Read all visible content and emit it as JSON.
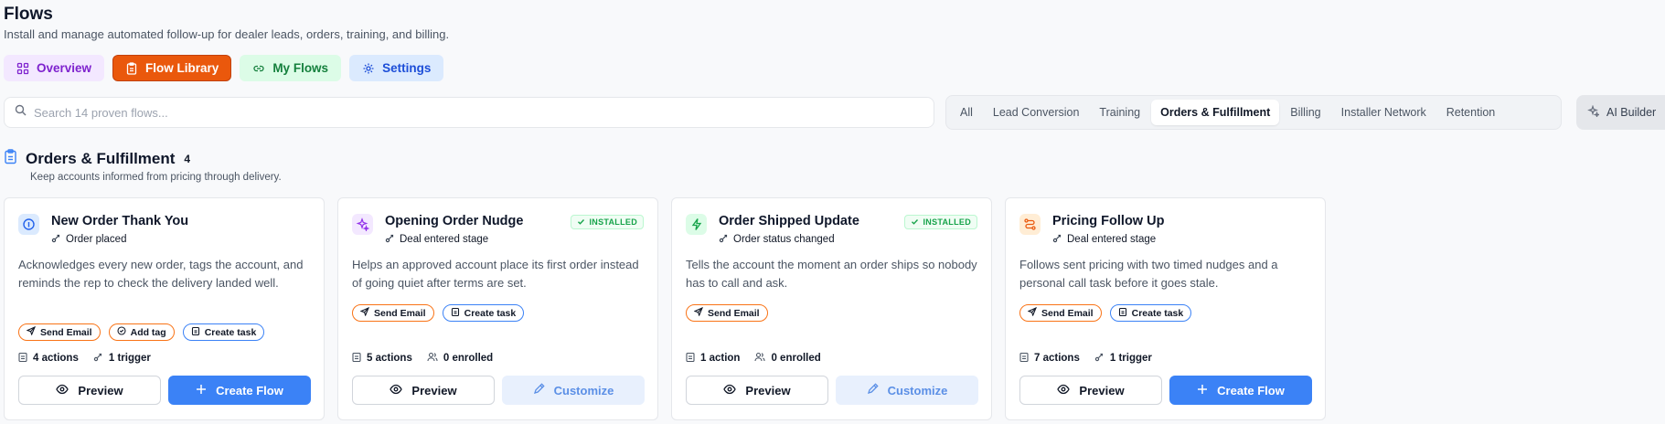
{
  "page": {
    "title": "Flows",
    "subtitle": "Install and manage automated follow-up for dealer leads, orders, training, and billing."
  },
  "tabs": [
    {
      "label": "Overview",
      "icon": "grid-icon"
    },
    {
      "label": "Flow Library",
      "icon": "clipboard-icon"
    },
    {
      "label": "My Flows",
      "icon": "link-icon"
    },
    {
      "label": "Settings",
      "icon": "gear-icon"
    }
  ],
  "search": {
    "placeholder": "Search 14 proven flows..."
  },
  "filters": [
    "All",
    "Lead Conversion",
    "Training",
    "Orders & Fulfillment",
    "Billing",
    "Installer Network",
    "Retention"
  ],
  "active_filter": "Orders & Fulfillment",
  "ai_builder": {
    "label": "AI Builder"
  },
  "section": {
    "title": "Orders & Fulfillment",
    "count": "4",
    "description": "Keep accounts informed from pricing through delivery."
  },
  "cards": [
    {
      "title": "New Order Thank You",
      "trigger": "Order placed",
      "installed": false,
      "description": "Acknowledges every new order, tags the account, and reminds the rep to check the delivery landed well.",
      "chips": [
        "Send Email",
        "Add tag",
        "Create task"
      ],
      "stat1": "4 actions",
      "stat2": "1 trigger",
      "preview_label": "Preview",
      "action_label": "Create Flow"
    },
    {
      "title": "Opening Order Nudge",
      "trigger": "Deal entered stage",
      "installed": true,
      "installed_label": "INSTALLED",
      "description": "Helps an approved account place its first order instead of going quiet after terms are set.",
      "chips": [
        "Send Email",
        "Create task"
      ],
      "stat1": "5 actions",
      "stat2": "0 enrolled",
      "preview_label": "Preview",
      "action_label": "Customize"
    },
    {
      "title": "Order Shipped Update",
      "trigger": "Order status changed",
      "installed": true,
      "installed_label": "INSTALLED",
      "description": "Tells the account the moment an order ships so nobody has to call and ask.",
      "chips": [
        "Send Email"
      ],
      "stat1": "1 action",
      "stat2": "0 enrolled",
      "preview_label": "Preview",
      "action_label": "Customize"
    },
    {
      "title": "Pricing Follow Up",
      "trigger": "Deal entered stage",
      "installed": false,
      "description": "Follows sent pricing with two timed nudges and a personal call task before it goes stale.",
      "chips": [
        "Send Email",
        "Create task"
      ],
      "stat1": "7 actions",
      "stat2": "1 trigger",
      "preview_label": "Preview",
      "action_label": "Create Flow"
    }
  ],
  "colors": {
    "accent_orange": "#ea580c",
    "primary_blue": "#3b82f6",
    "installed_green": "#16a34a"
  }
}
